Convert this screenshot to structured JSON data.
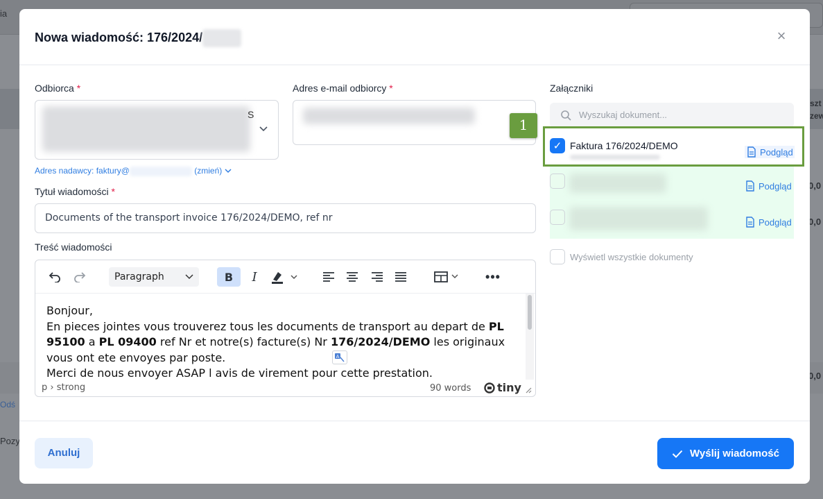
{
  "background": {
    "top_left_fragment": "ia",
    "left_fragment_1": "Odś",
    "left_fragment_2": "Pozy",
    "right_fragment_1": "szt",
    "right_fragment_2": "zew",
    "right_fragment_3": "0,0",
    "right_fragment_4": "0,0",
    "right_fragment_5": "0,0"
  },
  "modal": {
    "title": "Nowa wiadomość: 176/2024/",
    "close_icon": "×"
  },
  "form": {
    "recipient_label": "Odbiorca",
    "recipient_visible_char": "S",
    "required_mark": "*",
    "email_label": "Adres e-mail odbiorcy",
    "sender_prefix": "Adres nadawcy: faktury@",
    "sender_change": "(zmień)",
    "subject_label": "Tytuł wiadomości",
    "subject_value": "Documents of the transport invoice 176/2024/DEMO, ref nr",
    "body_label": "Treść wiadomości"
  },
  "editor": {
    "block_format": "Paragraph",
    "line1": "Bonjour,",
    "p2_a": "En pieces jointes vous trouverez tous les documents de transport au depart de ",
    "p2_b": "PL 95100",
    "p2_c": " a ",
    "p2_d": "PL 09400",
    "p2_e": " ref Nr et notre(s) facture(s) Nr ",
    "p2_f": "176/2024/DEMO",
    "p2_g": " les originaux vous ont ete envoyes par poste.",
    "line3": "Merci de nous envoyer ASAP l avis de virement pour cette prestation.",
    "path": "p › strong",
    "word_count": "90 words",
    "brand": "tiny"
  },
  "attachments": {
    "label": "Załączniki",
    "search_placeholder": "Wyszukaj dokument...",
    "item1_title": "Faktura 176/2024/DEMO",
    "preview_label": "Podgląd",
    "show_all": "Wyświetl wszystkie dokumenty",
    "callout_number": "1",
    "item_checked": [
      true,
      false,
      false
    ]
  },
  "footer": {
    "cancel_label": "Anuluj",
    "send_label": "Wyślij wiadomość"
  },
  "colors": {
    "accent": "#1677f6",
    "highlight": "#6a9d3f",
    "selected_row": "#e9fdf0"
  }
}
